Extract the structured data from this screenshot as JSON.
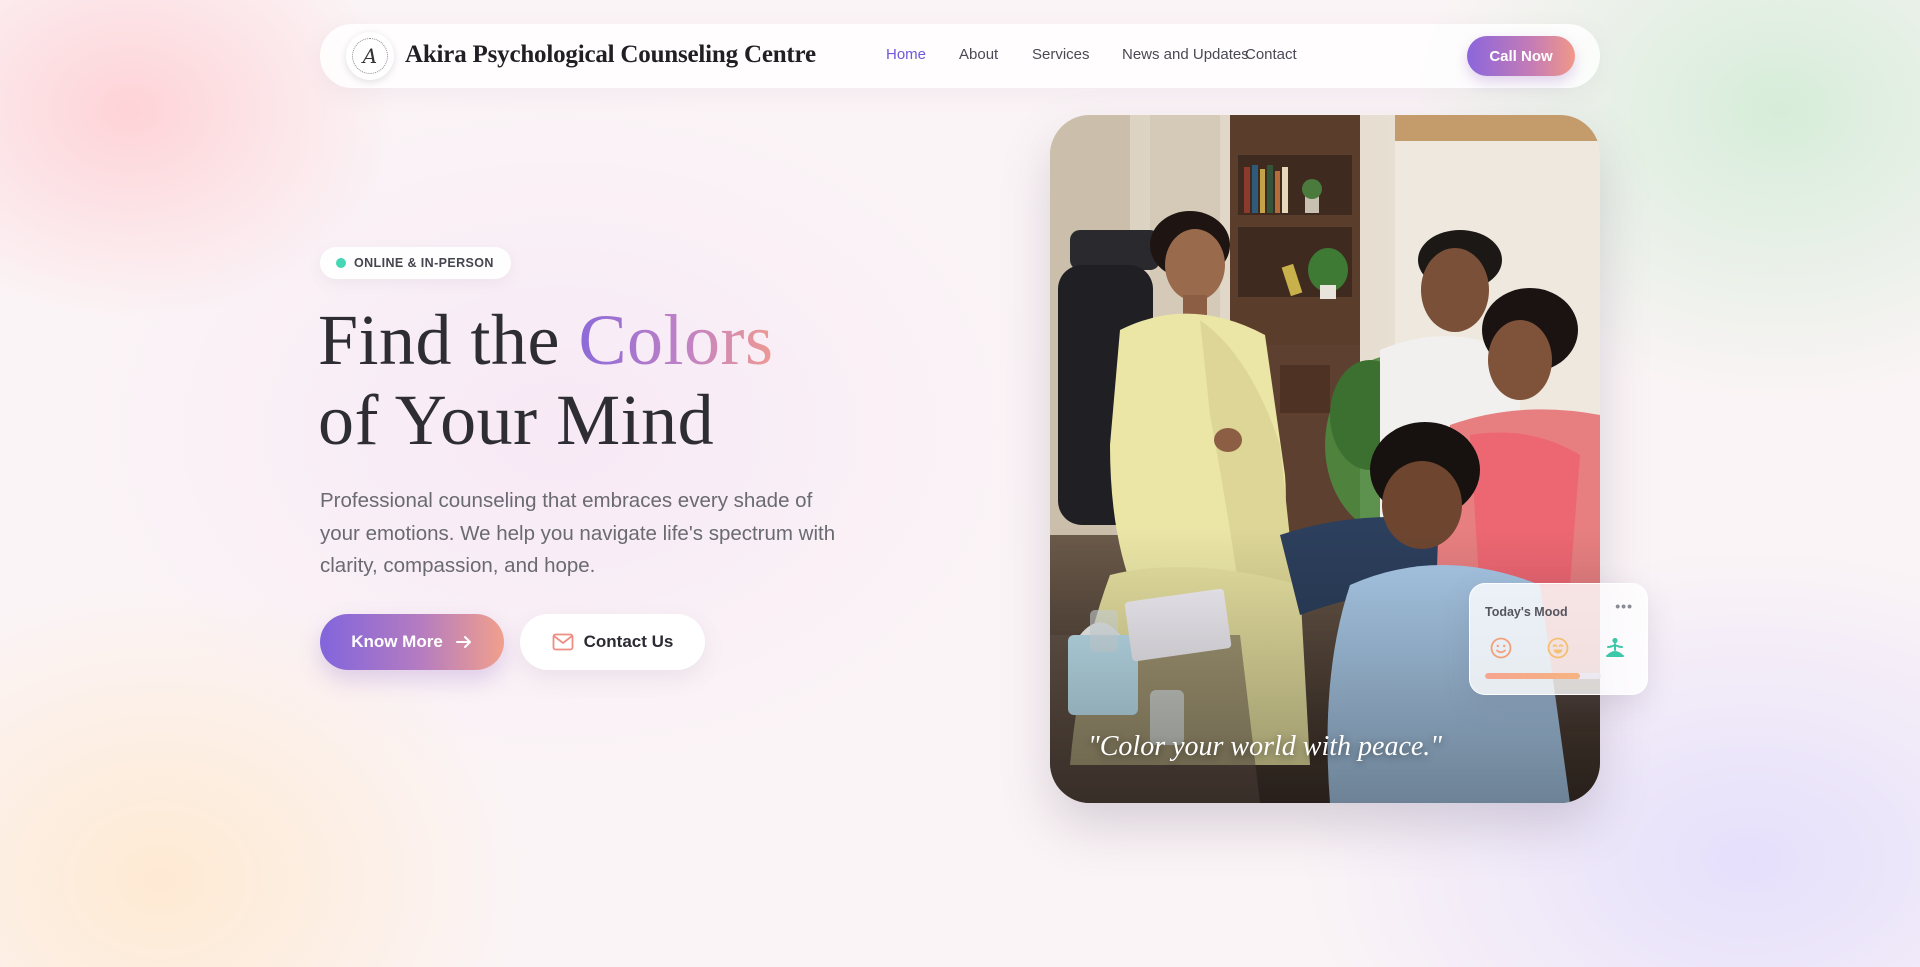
{
  "nav": {
    "logo_letter": "A",
    "brand": "Akira Psychological Counseling Centre",
    "links": [
      {
        "label": "Home",
        "active": true
      },
      {
        "label": "About"
      },
      {
        "label": "Services"
      },
      {
        "label": "News and Updates"
      },
      {
        "label": "Contact"
      }
    ],
    "cta": "Call Now"
  },
  "hero": {
    "badge": "ONLINE & IN-PERSON",
    "headline_part1": "Find the ",
    "headline_accent": "Colors",
    "headline_part2": "of Your Mind",
    "lead": "Professional counseling that embraces every shade of your emotions. We help you navigate life's spectrum with clarity, compassion, and hope.",
    "primary_button": "Know More",
    "secondary_button": "Contact Us",
    "quote": "\"Color your world with peace.\""
  },
  "mood_widget": {
    "title": "Today's Mood",
    "more": "•••",
    "icons": [
      "smile-icon",
      "grin-icon",
      "meditation-icon"
    ],
    "level": 0.82
  },
  "colors": {
    "accent_purple": "#7257d8",
    "gradient_start": "#8265dc",
    "gradient_end": "#f1a08c",
    "badge_dot": "#44d6b5"
  }
}
